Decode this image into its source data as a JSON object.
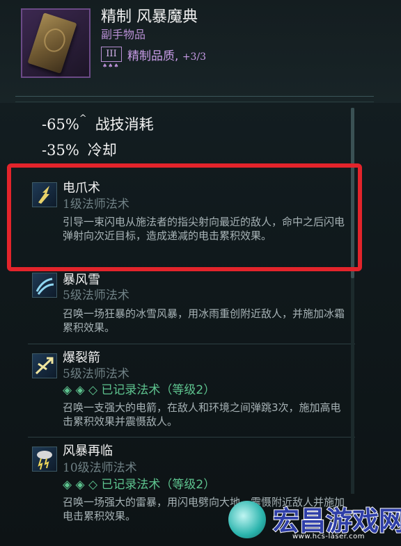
{
  "item": {
    "title": "精制 风暴魔典",
    "subtitle": "副手物品",
    "tier_numeral": "III",
    "quality_label": "精制品质, ",
    "quality_value": "+3/3",
    "icon": "grimoire-book-icon"
  },
  "stats": [
    {
      "value": "-65%",
      "marker": "^",
      "label": "战技消耗"
    },
    {
      "value": "-35%",
      "marker": "",
      "label": "冷却"
    }
  ],
  "skills": [
    {
      "name": "电爪术",
      "level": "1级法师法术",
      "recorded": "",
      "desc": "引导一束闪电从施法者的指尖射向最近的敌人，命中之后闪电弹射向次近目标，造成递减的电击累积效果。",
      "icon": "lightning-claw-icon"
    },
    {
      "name": "暴风雪",
      "level": "5级法师法术",
      "recorded": "",
      "desc": "召唤一场狂暴的冰雪风暴，用冰雨重创附近敌人，并施加冰霜累积效果。",
      "icon": "blizzard-icon"
    },
    {
      "name": "爆裂箭",
      "level": "5级法师法术",
      "recorded": "◈ ◈ ◇  已记录法术（等级2）",
      "desc": "召唤一支强大的电箭，在敌人和环境之间弹跳3次，施加高电击累积效果并震慑敌人。",
      "icon": "lightning-arrow-icon"
    },
    {
      "name": "风暴再临",
      "level": "10级法师法术",
      "recorded": "◈ ◈ ◇  已记录法术（等级2）",
      "desc": "召唤一场强大的雷暴，用闪电劈向大地，震慑附近敌人并施加电击累积效果。",
      "icon": "thunderstorm-icon"
    }
  ],
  "watermark": {
    "text": "宏昌游戏网",
    "url": "www.hcs-laser.com"
  },
  "colors": {
    "highlight": "#e3242b",
    "refined": "#c79be6",
    "recorded": "#5ec48f"
  }
}
